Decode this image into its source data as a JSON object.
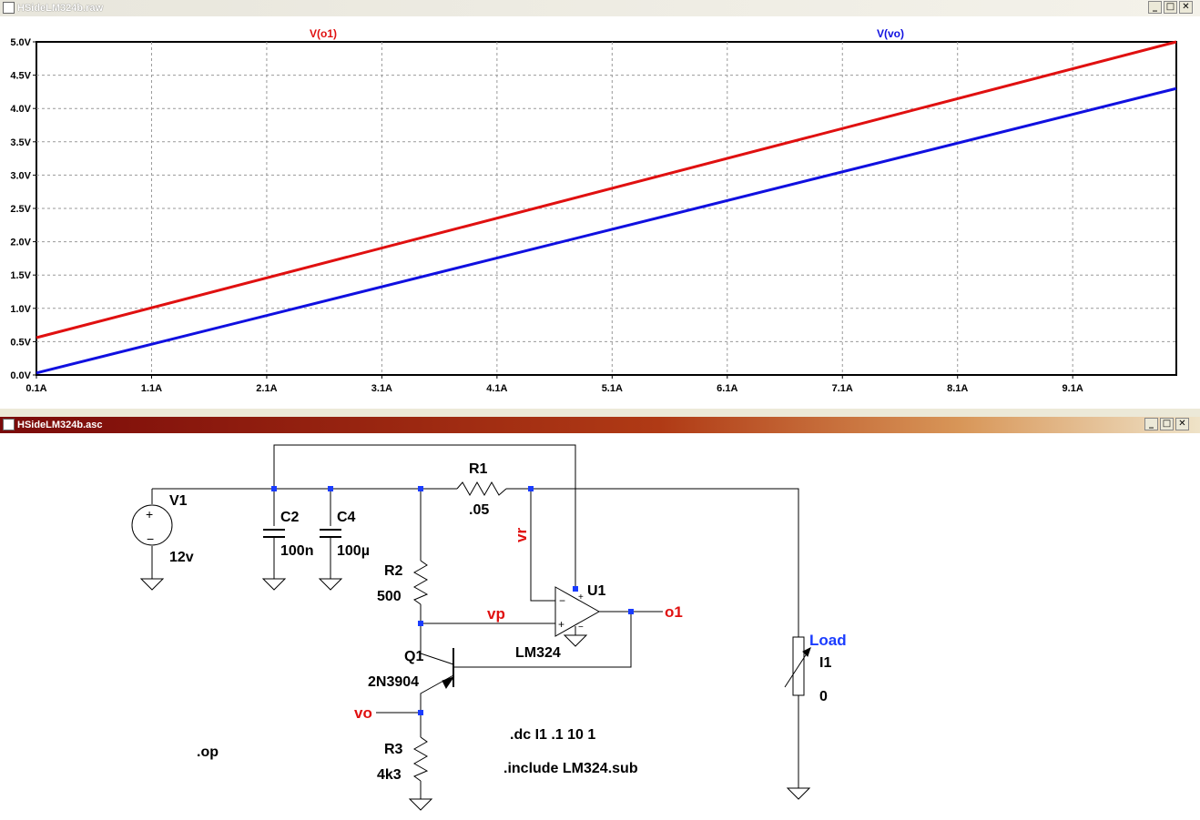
{
  "windows": {
    "waveform": {
      "title": "HSideLM324b.raw"
    },
    "schematic": {
      "title": "HSideLM324b.asc"
    }
  },
  "colors": {
    "trace_o1": "#e01010",
    "trace_vo": "#1010e0",
    "wire": "#000000",
    "junction": "#1a3cff",
    "net_label": "#e01010",
    "directive_label": "#1a3cff"
  },
  "chart_data": {
    "type": "line",
    "title": "",
    "xlabel": "",
    "ylabel": "",
    "x_tick_labels": [
      "0.1A",
      "1.1A",
      "2.1A",
      "3.1A",
      "4.1A",
      "5.1A",
      "6.1A",
      "7.1A",
      "8.1A",
      "9.1A"
    ],
    "y_tick_labels": [
      "0.0V",
      "0.5V",
      "1.0V",
      "1.5V",
      "2.0V",
      "2.5V",
      "3.0V",
      "3.5V",
      "4.0V",
      "4.5V",
      "5.0V"
    ],
    "xlim": [
      0.1,
      10.0
    ],
    "ylim": [
      0.0,
      5.0
    ],
    "grid": true,
    "x": [
      0.1,
      10.0
    ],
    "series": [
      {
        "name": "V(o1)",
        "color": "#e01010",
        "values": [
          0.56,
          5.0
        ]
      },
      {
        "name": "V(vo)",
        "color": "#1010e0",
        "values": [
          0.03,
          4.3
        ]
      }
    ]
  },
  "schematic": {
    "components": {
      "v1": {
        "ref": "V1",
        "value": "12v"
      },
      "c2": {
        "ref": "C2",
        "value": "100n"
      },
      "c4": {
        "ref": "C4",
        "value": "100µ"
      },
      "r1": {
        "ref": "R1",
        "value": ".05"
      },
      "r2": {
        "ref": "R2",
        "value": "500"
      },
      "r3": {
        "ref": "R3",
        "value": "4k3"
      },
      "q1": {
        "ref": "Q1",
        "value": "2N3904"
      },
      "u1": {
        "ref": "U1",
        "value": "LM324"
      },
      "i1": {
        "ref": "I1",
        "value": "0",
        "label": "Load"
      }
    },
    "nets": {
      "vr": "vr",
      "vp": "vp",
      "vo": "vo",
      "o1": "o1"
    },
    "directives": {
      "op": ".op",
      "dc": ".dc I1 .1 10 1",
      "include": ".include LM324.sub"
    },
    "pins": {
      "plus": "+",
      "minus": "−"
    }
  }
}
